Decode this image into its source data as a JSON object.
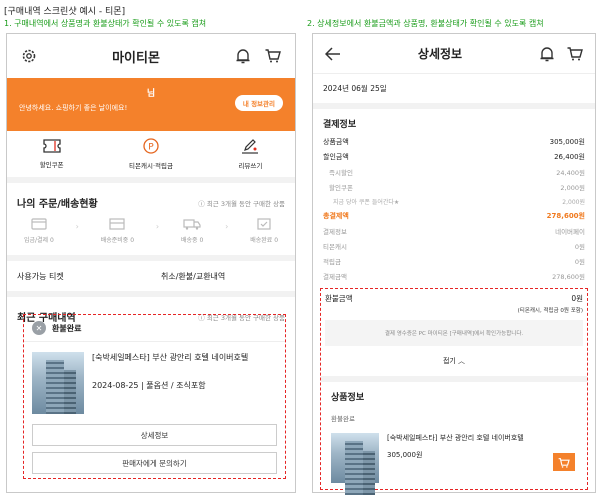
{
  "doc": {
    "title": "[구매내역 스크린샷 예시 - 티몬]",
    "caption_left": "1. 구매내역에서 상품명과 환불상태가 확인될 수 있도록 캡쳐",
    "caption_right": "2. 상세정보에서 환불금액과 상품명, 환불상태가 확인될 수 있도록 캡쳐"
  },
  "left": {
    "header_title": "마이티몬",
    "user_name": "님",
    "greeting": "안녕하세요. 쇼핑하기 좋은 날이에요!",
    "myinfo_button": "내 정보관리",
    "quick": [
      {
        "label": "할인쿠폰",
        "icon": "ticket-icon"
      },
      {
        "label": "티몬캐시·적립금",
        "icon": "p-coin-icon"
      },
      {
        "label": "리뷰쓰기",
        "icon": "review-pen-icon"
      }
    ],
    "orders_title": "나의 주문/배송현황",
    "orders_sub": "ⓘ 최근 3개월 동안 구매한 상품",
    "steps": [
      "입금/결제 0",
      "배송준비중 0",
      "배송중 0",
      "배송완료 0"
    ],
    "ticket": "사용가능 티켓",
    "cancel": "취소/환불/교환내역",
    "recent_title": "최근 구매내역",
    "recent_sub": "ⓘ 최근 3개월 동안 구매한 상품",
    "status": "환불완료",
    "product_name": "[숙박세일페스타] 부산 광안리 호텔 네이버호텔",
    "product_date": "2024-08-25 | 풀옵션 / 조식포함",
    "detail_button": "상세정보",
    "inquiry_button": "판매자에게 문의하기"
  },
  "right": {
    "header_title": "상세정보",
    "date": "2024년 06월 25일",
    "pay_title": "결제정보",
    "rows": [
      {
        "label": "상품금액",
        "value": "305,000원",
        "cls": "row"
      },
      {
        "label": "할인금액",
        "value": "26,400원",
        "cls": "row"
      },
      {
        "label": "즉시할인",
        "value": "24,400원",
        "cls": "row sub"
      },
      {
        "label": "할인쿠폰",
        "value": "2,000원",
        "cls": "row sub"
      },
      {
        "label": "지금 당아 쿠폰 들어간다★",
        "value": "2,000원",
        "cls": "row subsub"
      },
      {
        "label": "총결제액",
        "value": "278,600원",
        "cls": "row orange-t"
      },
      {
        "label": "결제정보",
        "value": "네이버페이",
        "cls": "row grey"
      },
      {
        "label": "티몬캐시",
        "value": "0원",
        "cls": "row grey"
      },
      {
        "label": "적립금",
        "value": "0원",
        "cls": "row grey"
      },
      {
        "label": "결제금액",
        "value": "278,600원",
        "cls": "row grey"
      }
    ],
    "refund_label": "환불금액",
    "refund_value": "0원",
    "refund_note": "(티몬캐시, 적립금 0원 포함)",
    "grey_note": "결제 영수증은 PC 마이티몬 [구매내역]에서 확인가능합니다.",
    "fold": "접기 ︿",
    "product_info_title": "상품정보",
    "product_status": "환불완료",
    "product_name": "[숙박세일페스타] 부산 광안리 호텔 네이버호텔",
    "product_price": "305,000원"
  }
}
